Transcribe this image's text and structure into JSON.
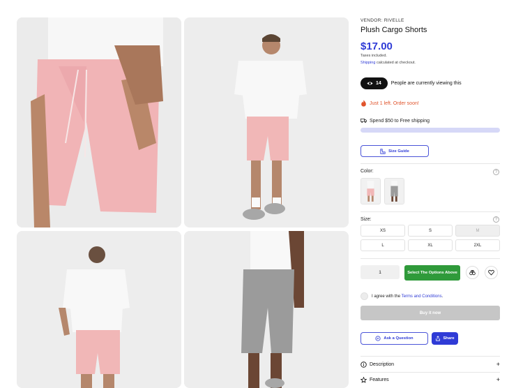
{
  "product": {
    "vendor": "VENDOR: RIVELLE",
    "title": "Plush Cargo Shorts",
    "price": "$17.00",
    "taxes": "Taxes included.",
    "shipping_link": "Shipping",
    "shipping_rest": " calculated at checkout."
  },
  "gallery": {
    "images": [
      "pink shorts close-up",
      "model front pink shorts",
      "model back pink shorts",
      "model grey shorts"
    ]
  },
  "viewers": {
    "count": "14",
    "text": "People are currently viewing this"
  },
  "stock": {
    "text": "Just 1 left. Order soon!"
  },
  "free_shipping": {
    "text": "Spend $50 to Free shipping",
    "progress": 0.0
  },
  "size_guide": {
    "label": "Size Guide"
  },
  "color": {
    "label": "Color:",
    "swatches": [
      "Pink",
      "Grey"
    ]
  },
  "size": {
    "label": "Size:",
    "options": [
      {
        "label": "XS",
        "available": true
      },
      {
        "label": "S",
        "available": true
      },
      {
        "label": "M",
        "available": false
      },
      {
        "label": "L",
        "available": true
      },
      {
        "label": "XL",
        "available": true
      },
      {
        "label": "2XL",
        "available": true
      }
    ]
  },
  "cart": {
    "quantity": "1",
    "select_label": "Select The Options Above",
    "compare_icon": "binoculars-icon",
    "wishlist_icon": "heart-icon"
  },
  "agree": {
    "prefix": "I agree with the ",
    "link": "Terms and Conditions",
    "suffix": "."
  },
  "buy_now": {
    "label": "Buy it now"
  },
  "actions": {
    "ask_label": "Ask a Question",
    "share_label": "Share"
  },
  "accordions": [
    {
      "label": "Description",
      "icon": "info-icon"
    },
    {
      "label": "Features",
      "icon": "star-icon"
    }
  ],
  "colors": {
    "accent": "#2f3bd6",
    "green": "#2f9a3a",
    "warning": "#e0532b"
  }
}
